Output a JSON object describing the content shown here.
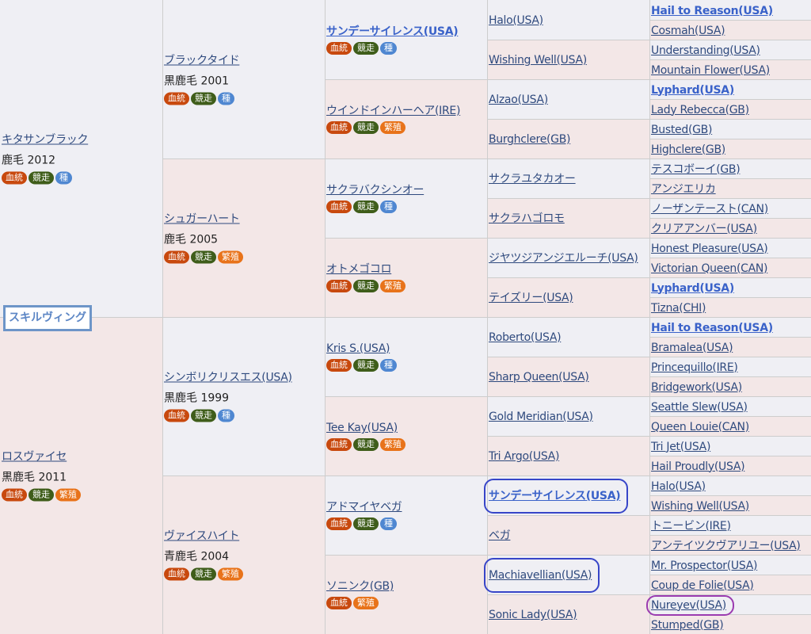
{
  "subject": {
    "name": "スキルヴィング"
  },
  "badge_labels": {
    "kettou": "血統",
    "kyoso": "競走",
    "shu": "種",
    "hanshoku": "繁殖"
  },
  "gen1": [
    {
      "name": "キタサンブラック",
      "coat": "鹿毛 2012",
      "badges": [
        "kettou",
        "kyoso",
        "shu"
      ]
    },
    {
      "name": "ロスヴァイセ",
      "coat": "黒鹿毛 2011",
      "badges": [
        "kettou",
        "kyoso",
        "hanshoku"
      ]
    }
  ],
  "gen2": [
    {
      "name": "ブラックタイド",
      "coat": "黒鹿毛 2001",
      "badges": [
        "kettou",
        "kyoso",
        "shu"
      ]
    },
    {
      "name": "シュガーハート",
      "coat": "鹿毛 2005",
      "badges": [
        "kettou",
        "kyoso",
        "hanshoku"
      ]
    },
    {
      "name": "シンボリクリスエス(USA)",
      "coat": "黒鹿毛 1999",
      "badges": [
        "kettou",
        "kyoso",
        "shu"
      ]
    },
    {
      "name": "ヴァイスハイト",
      "coat": "青鹿毛 2004",
      "badges": [
        "kettou",
        "kyoso",
        "hanshoku"
      ]
    }
  ],
  "gen3": [
    {
      "name": "サンデーサイレンス(USA)",
      "bold": true,
      "badges": [
        "kettou",
        "kyoso",
        "shu"
      ]
    },
    {
      "name": "ウインドインハーヘア(IRE)",
      "badges": [
        "kettou",
        "kyoso",
        "hanshoku"
      ]
    },
    {
      "name": "サクラバクシンオー",
      "badges": [
        "kettou",
        "kyoso",
        "shu"
      ]
    },
    {
      "name": "オトメゴコロ",
      "badges": [
        "kettou",
        "kyoso",
        "hanshoku"
      ]
    },
    {
      "name": "Kris S.(USA)",
      "badges": [
        "kettou",
        "kyoso",
        "shu"
      ]
    },
    {
      "name": "Tee Kay(USA)",
      "badges": [
        "kettou",
        "kyoso",
        "hanshoku"
      ]
    },
    {
      "name": "アドマイヤベガ",
      "badges": [
        "kettou",
        "kyoso",
        "shu"
      ]
    },
    {
      "name": "ソニンク(GB)",
      "badges": [
        "kettou",
        "hanshoku"
      ]
    }
  ],
  "gen4": [
    {
      "name": "Halo(USA)"
    },
    {
      "name": "Wishing Well(USA)"
    },
    {
      "name": "Alzao(USA)"
    },
    {
      "name": "Burghclere(GB)"
    },
    {
      "name": "サクラユタカオー"
    },
    {
      "name": "サクラハゴロモ"
    },
    {
      "name": "ジヤツジアンジエルーチ(USA)"
    },
    {
      "name": "テイズリー(USA)"
    },
    {
      "name": "Roberto(USA)"
    },
    {
      "name": "Sharp Queen(USA)"
    },
    {
      "name": "Gold Meridian(USA)"
    },
    {
      "name": "Tri Argo(USA)"
    },
    {
      "name": "サンデーサイレンス(USA)",
      "bold": true
    },
    {
      "name": "ベガ"
    },
    {
      "name": "Machiavellian(USA)"
    },
    {
      "name": "Sonic Lady(USA)"
    }
  ],
  "gen5": [
    {
      "name": "Hail to Reason(USA)",
      "bold": true
    },
    {
      "name": "Cosmah(USA)"
    },
    {
      "name": "Understanding(USA)"
    },
    {
      "name": "Mountain Flower(USA)"
    },
    {
      "name": "Lyphard(USA)",
      "bold": true
    },
    {
      "name": "Lady Rebecca(GB)"
    },
    {
      "name": "Busted(GB)"
    },
    {
      "name": "Highclere(GB)"
    },
    {
      "name": "テスコボーイ(GB)"
    },
    {
      "name": "アンジエリカ"
    },
    {
      "name": "ノーザンテースト(CAN)"
    },
    {
      "name": "クリアアンバー(USA)"
    },
    {
      "name": "Honest Pleasure(USA)"
    },
    {
      "name": "Victorian Queen(CAN)"
    },
    {
      "name": "Lyphard(USA)",
      "bold": true
    },
    {
      "name": "Tizna(CHI)"
    },
    {
      "name": "Hail to Reason(USA)",
      "bold": true
    },
    {
      "name": "Bramalea(USA)"
    },
    {
      "name": "Princequillo(IRE)"
    },
    {
      "name": "Bridgework(USA)"
    },
    {
      "name": "Seattle Slew(USA)"
    },
    {
      "name": "Queen Louie(CAN)"
    },
    {
      "name": "Tri Jet(USA)"
    },
    {
      "name": "Hail Proudly(USA)"
    },
    {
      "name": "Halo(USA)"
    },
    {
      "name": "Wishing Well(USA)"
    },
    {
      "name": "トニービン(IRE)"
    },
    {
      "name": "アンテイツクヴアリユー(USA)"
    },
    {
      "name": "Mr. Prospector(USA)"
    },
    {
      "name": "Coup de Folie(USA)"
    },
    {
      "name": "Nureyev(USA)"
    },
    {
      "name": "Stumped(GB)"
    }
  ],
  "highlights": [
    {
      "target": "gen4-12",
      "color": "blue"
    },
    {
      "target": "gen4-14",
      "color": "blue"
    },
    {
      "target": "gen5-30",
      "color": "purple"
    }
  ]
}
